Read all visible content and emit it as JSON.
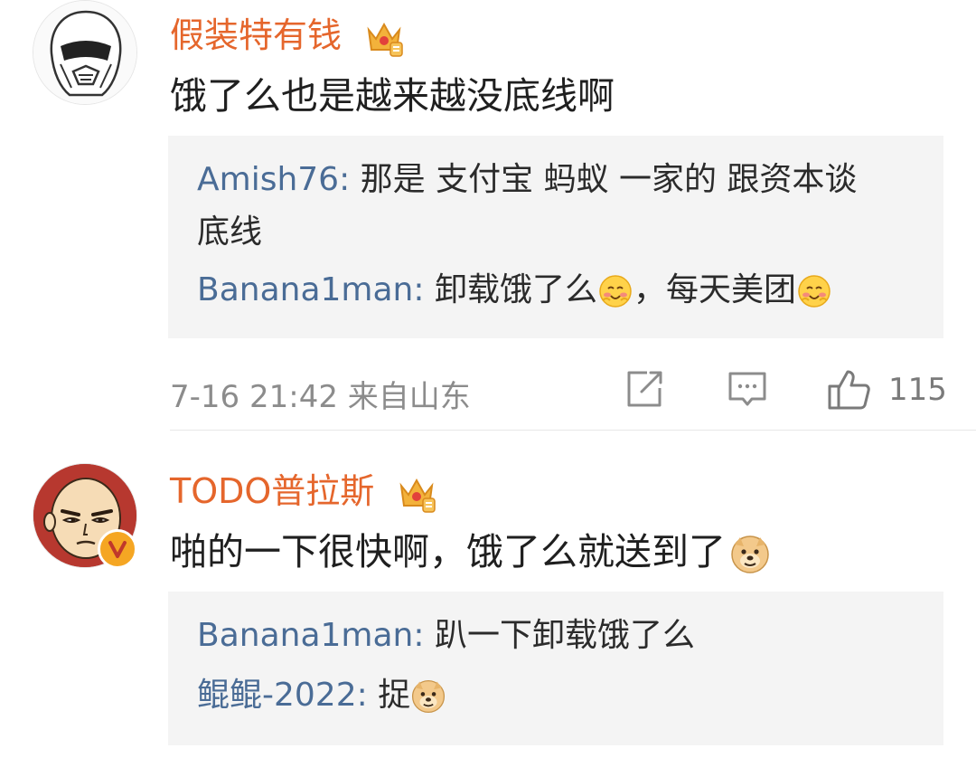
{
  "comments": [
    {
      "username": "假装特有钱",
      "text": "饿了么也是越来越没底线啊",
      "replies": [
        {
          "name": "Amish76",
          "sep": ": ",
          "text1": "那是 支付宝 蚂蚁 一家的 跟资本谈",
          "text2": "底线"
        },
        {
          "name": "Banana1man",
          "sep": ": ",
          "text_a": "卸载饿了么",
          "text_b": "，每天美团"
        }
      ],
      "time_location": "7-16 21:42 来自山东",
      "like_count": "115"
    },
    {
      "username": "TODO普拉斯",
      "text": "啪的一下很快啊，饿了么就送到了",
      "replies": [
        {
          "name": "Banana1man",
          "sep": ": ",
          "text": "趴一下卸载饿了么"
        },
        {
          "name": "鲲鲲-2022",
          "sep": ": ",
          "text": "捉"
        }
      ]
    }
  ],
  "icons": {
    "crown": "crown-vip-icon",
    "share": "share-icon",
    "comment": "comment-icon",
    "like": "thumbs-up-icon",
    "blush": "blush-emoji-icon",
    "doge": "doge-emoji-icon",
    "verified": "verified-v-icon"
  },
  "colors": {
    "username": "#e5662c",
    "reply_name": "#4a6c96",
    "reply_bg": "#f4f4f4",
    "meta": "#8c8c8c"
  }
}
